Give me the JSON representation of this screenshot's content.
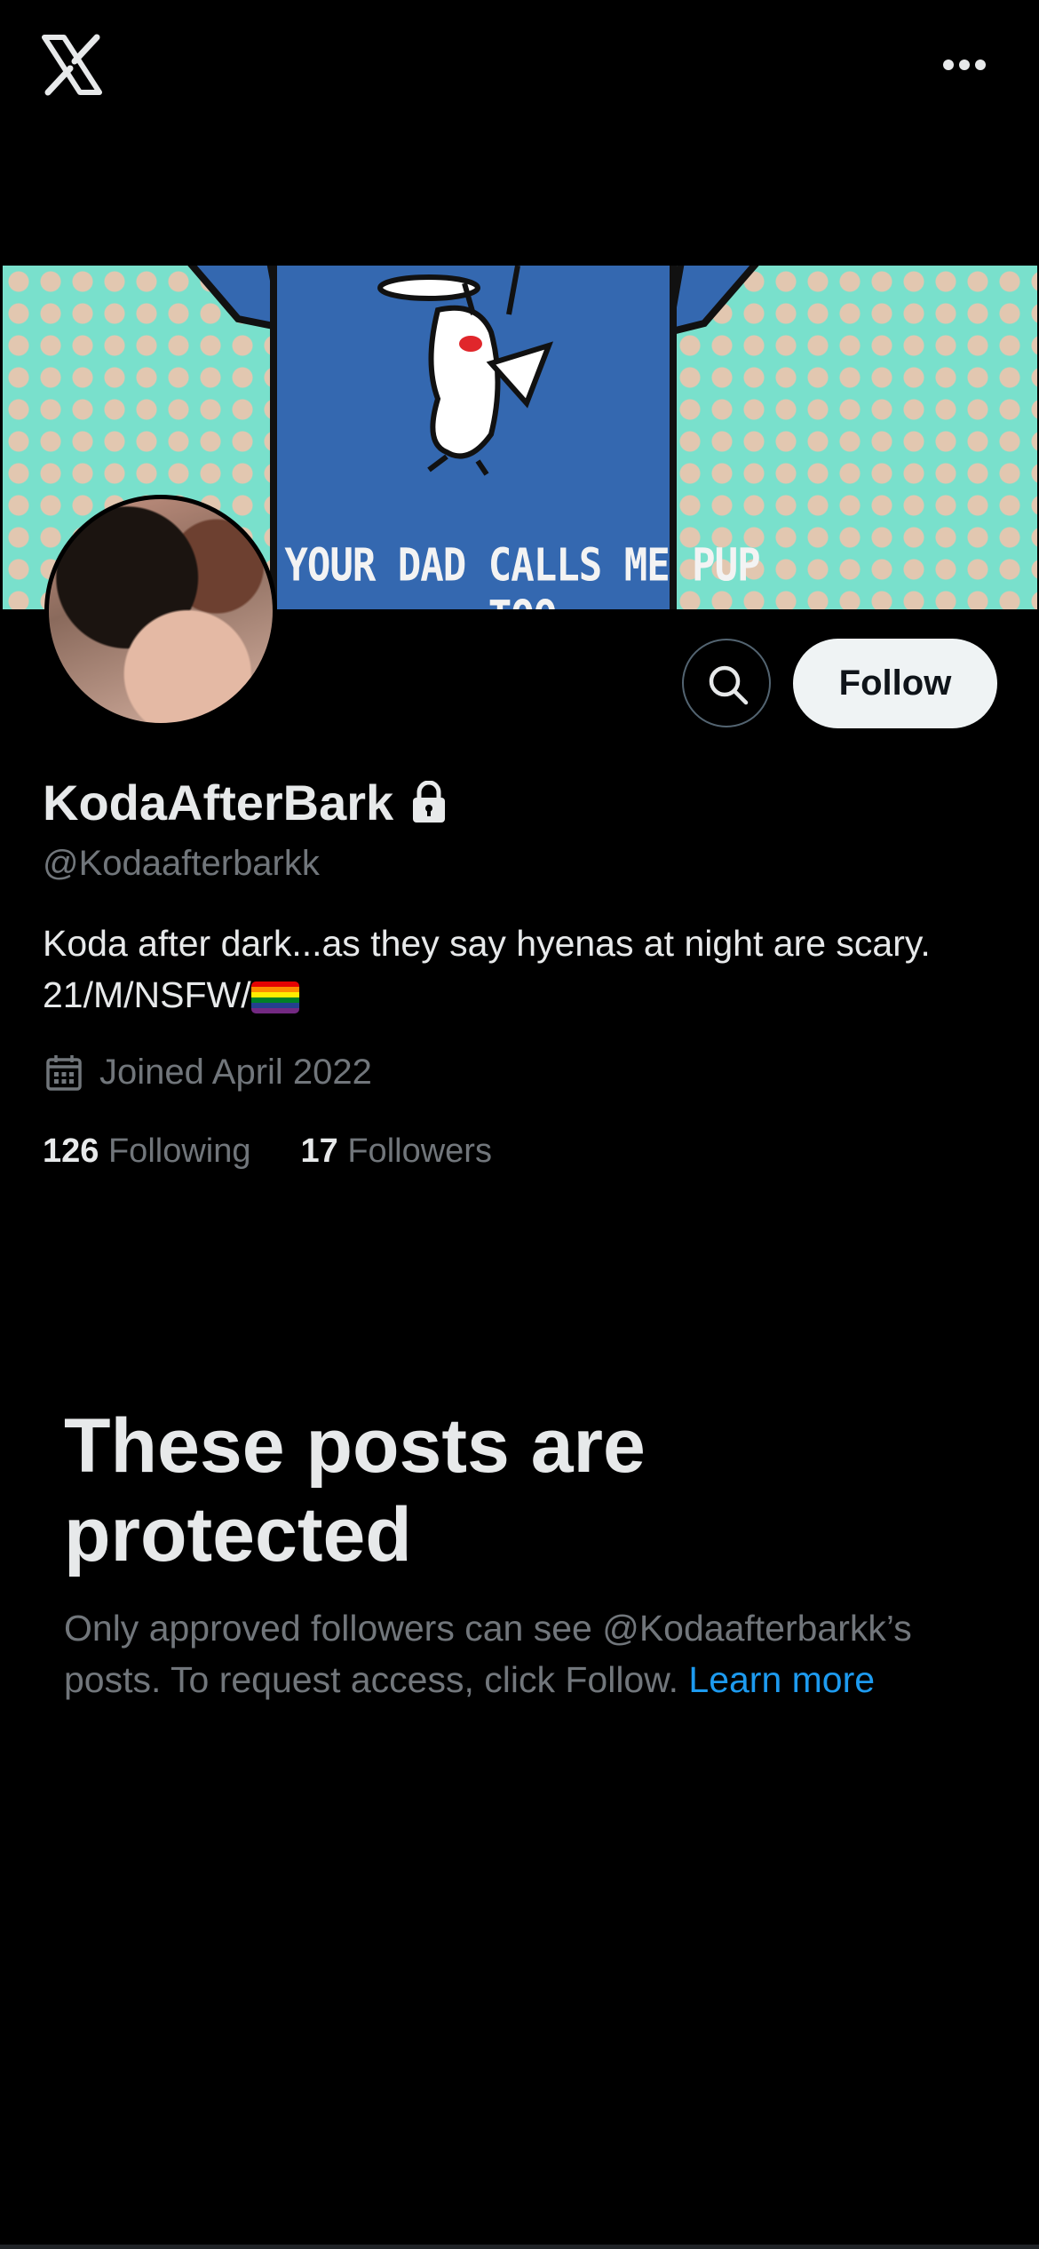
{
  "topbar": {
    "logo": "x-logo-icon",
    "more": "more-options-icon"
  },
  "banner": {
    "text": "YOUR DAD CALLS ME PUP TOO"
  },
  "profile": {
    "display_name": "KodaAfterBark",
    "handle": "@Kodaafterbarkk",
    "bio_line1": "Koda after dark...as they say hyenas at night are scary.",
    "bio_line2": "21/M/NSFW/",
    "joined": "Joined April 2022",
    "following_count": "126",
    "following_label": "Following",
    "followers_count": "17",
    "followers_label": "Followers"
  },
  "actions": {
    "follow_label": "Follow",
    "search_icon": "search-icon"
  },
  "protected": {
    "title": "These posts are protected",
    "text": "Only approved followers can see @Kodaafterbarkk’s posts. To request access, click Follow.",
    "link": "Learn more"
  },
  "colors": {
    "background": "#000000",
    "text": "#e7e9ea",
    "muted": "#71767b",
    "link": "#1d9bf0",
    "follow_bg": "#eff3f4"
  }
}
